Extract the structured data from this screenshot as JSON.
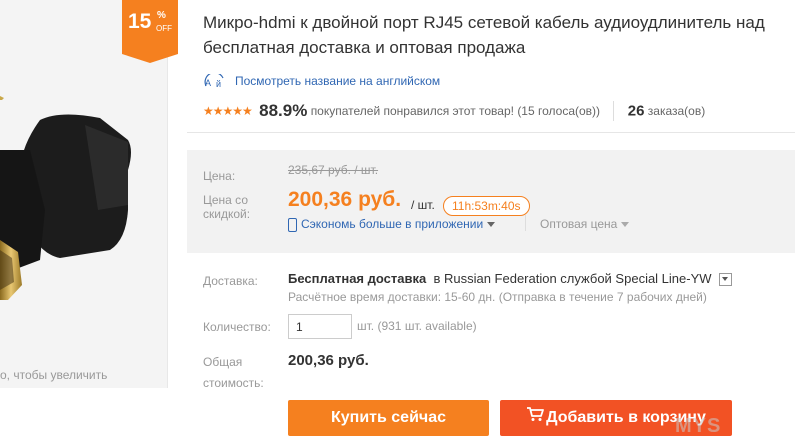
{
  "badge": {
    "number": "15",
    "percent": "%",
    "off": "OFF"
  },
  "image_hint": "о, чтобы увеличить",
  "title": "Микро-hdmi к двойной порт RJ45 сетевой кабель аудиоудлинитель над бесплатная доставка и оптовая продажа",
  "translate_link": "Посмотреть название на английском",
  "rating": {
    "stars": "★★★★★",
    "percent": "88.9%",
    "text": "покупателей понравился этот товар! (15 голоса(ов))",
    "orders_count": "26",
    "orders_label": "заказа(ов)"
  },
  "price": {
    "label_price": "Цена:",
    "old_price": "235,67 руб. / шт.",
    "label_discount": "Цена со скидкой:",
    "new_price": "200,36 руб.",
    "per_unit": "/ шт.",
    "timer": "11h:53m:40s",
    "app_link": "Сэкономь больше в приложении",
    "wholesale": "Оптовая цена"
  },
  "shipping": {
    "label": "Доставка:",
    "free": "Бесплатная доставка",
    "to_prefix": "в",
    "details": "Russian Federation службой Special Line-YW",
    "estimate": "Расчётное время доставки: 15-60 дн. (Отправка в течение 7 рабочих дней)"
  },
  "quantity": {
    "label": "Количество:",
    "value": "1",
    "available": "шт. (931 шт. available)"
  },
  "total": {
    "label": "Общая стоимость:",
    "value": "200,36 руб."
  },
  "buttons": {
    "buy_now": "Купить сейчас",
    "add_to_cart": "Добавить в корзину"
  },
  "watermark": "MYS",
  "colors": {
    "accent_orange": "#f5801f",
    "cart_red": "#f25224",
    "link_blue": "#3067b3"
  }
}
